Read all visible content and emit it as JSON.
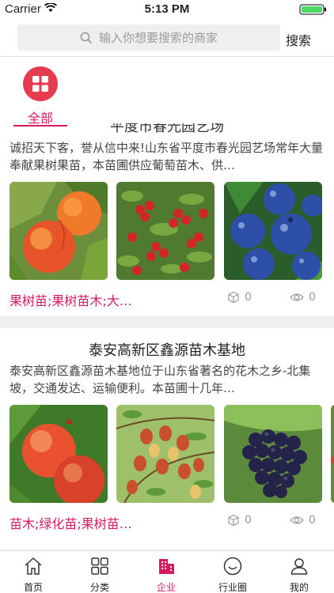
{
  "status_bar": {
    "carrier": "Carrier",
    "time": "5:13 PM"
  },
  "search": {
    "placeholder": "输入你想要搜索的商家",
    "button_label": "搜索"
  },
  "category": {
    "label": "全部"
  },
  "companies": [
    {
      "title": "平度市春光园艺场",
      "description": "诚招天下客，誉从信中来!山东省平度市春光园艺场常年大量奉献果树果苗，本苗圃供应葡萄苗木、供…",
      "tags": "果树苗;果树苗木;大…",
      "views": "0",
      "likes": "0",
      "thumbs": [
        "peach-fruit",
        "hawthorn-berries",
        "blueberries"
      ]
    },
    {
      "title": "泰安高新区鑫源苗木基地",
      "description": "泰安高新区鑫源苗木基地位于山东省著名的花木之乡-北集坡，交通发达、运输便利。本苗圃十几年…",
      "tags": "苗木;绿化苗;果树苗…",
      "views": "0",
      "likes": "0",
      "thumbs": [
        "pomegranate",
        "jujube-dates",
        "grapes"
      ]
    }
  ],
  "tabs": [
    {
      "label": "首页",
      "icon": "home-icon"
    },
    {
      "label": "分类",
      "icon": "grid-icon"
    },
    {
      "label": "企业",
      "icon": "building-icon",
      "active": true
    },
    {
      "label": "行业圈",
      "icon": "smile-icon"
    },
    {
      "label": "我的",
      "icon": "user-icon"
    }
  ],
  "colors": {
    "accent": "#d81b60",
    "chip": "#e53c4f"
  }
}
